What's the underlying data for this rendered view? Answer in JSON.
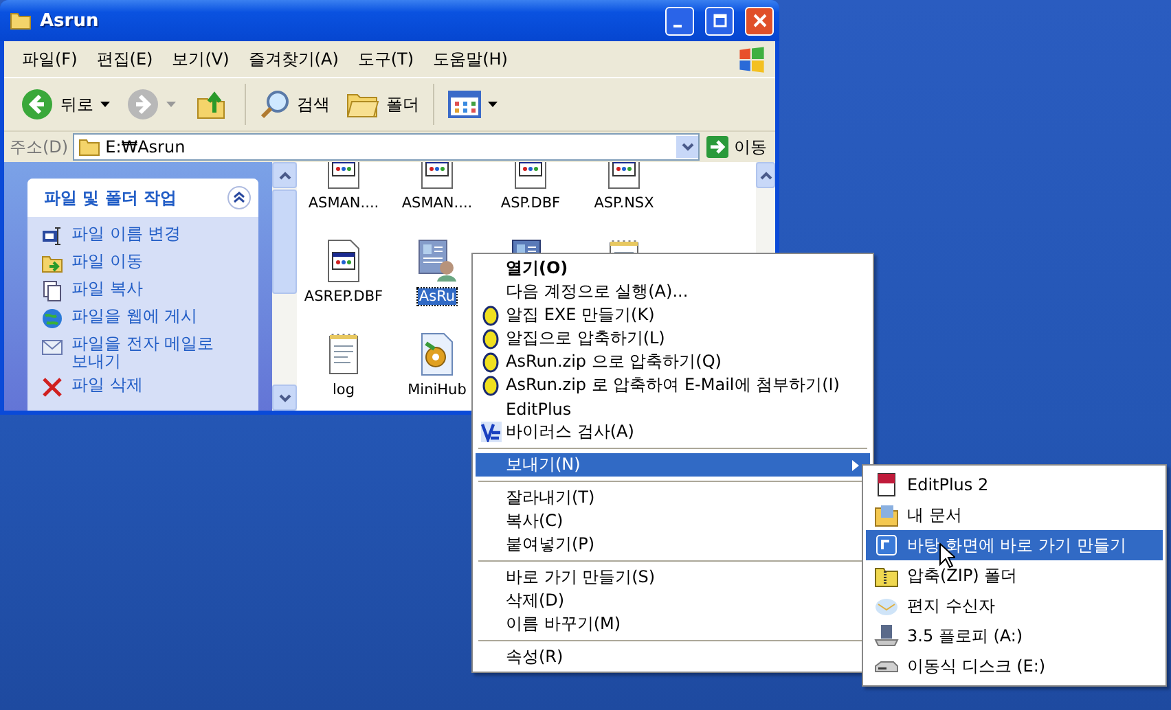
{
  "window": {
    "title": "Asrun"
  },
  "menu_bar": [
    "파일(F)",
    "편집(E)",
    "보기(V)",
    "즐겨찾기(A)",
    "도구(T)",
    "도움말(H)"
  ],
  "toolbar": {
    "back": "뒤로",
    "search": "검색",
    "folders": "폴더"
  },
  "address": {
    "label": "주소(D)",
    "value": "E:₩Asrun",
    "go": "이동"
  },
  "task_panel": {
    "title": "파일 및 폴더 작업",
    "tasks": [
      {
        "label": "파일 이름 변경",
        "kind": "rename"
      },
      {
        "label": "파일 이동",
        "kind": "move"
      },
      {
        "label": "파일 복사",
        "kind": "copy"
      },
      {
        "label": "파일을 웹에 게시",
        "kind": "web"
      },
      {
        "label": "파일을 전자 메일로 보내기",
        "kind": "mail"
      },
      {
        "label": "파일 삭제",
        "kind": "delete"
      }
    ]
  },
  "files": [
    {
      "name": "ASMAN....",
      "kind": "dbf",
      "selected": false
    },
    {
      "name": "ASMAN....",
      "kind": "dbf",
      "selected": false
    },
    {
      "name": "ASP.DBF",
      "kind": "dbf",
      "selected": false
    },
    {
      "name": "ASP.NSX",
      "kind": "dbf",
      "selected": false
    },
    {
      "name": "ASREP.DBF",
      "kind": "dbf",
      "selected": false
    },
    {
      "name": "AsRu",
      "kind": "user",
      "selected": true
    },
    {
      "kind": "card",
      "selected": false
    },
    {
      "kind": "notepad",
      "selected": false
    },
    {
      "name": "log",
      "kind": "notepad",
      "selected": false
    },
    {
      "name": "MiniHub",
      "kind": "gear",
      "selected": false
    }
  ],
  "context_menu": [
    [
      {
        "label": "열기(O)",
        "kind": "default",
        "selected": false
      },
      {
        "label": "다음 계정으로 실행(A)...",
        "kind": "plain",
        "selected": false
      },
      {
        "label": "알집 EXE 만들기(K)",
        "kind": "alzip",
        "selected": false
      },
      {
        "label": "알집으로 압축하기(L)",
        "kind": "alzip",
        "selected": false
      },
      {
        "label": "AsRun.zip 으로 압축하기(Q)",
        "kind": "alzip",
        "selected": false
      },
      {
        "label": "AsRun.zip 로 압축하여 E-Mail에 첨부하기(I)",
        "kind": "alzip",
        "selected": false
      },
      {
        "label": "EditPlus",
        "kind": "plain",
        "selected": false
      },
      {
        "label": "바이러스 검사(A)",
        "kind": "virus",
        "selected": false
      }
    ],
    [
      {
        "label": "보내기(N)",
        "kind": "submenu",
        "selected": true
      }
    ],
    [
      {
        "label": "잘라내기(T)",
        "kind": "plain",
        "selected": false
      },
      {
        "label": "복사(C)",
        "kind": "plain",
        "selected": false
      },
      {
        "label": "붙여넣기(P)",
        "kind": "plain",
        "selected": false
      }
    ],
    [
      {
        "label": "바로 가기 만들기(S)",
        "kind": "plain",
        "selected": false
      },
      {
        "label": "삭제(D)",
        "kind": "plain",
        "selected": false
      },
      {
        "label": "이름 바꾸기(M)",
        "kind": "plain",
        "selected": false
      }
    ],
    [
      {
        "label": "속성(R)",
        "kind": "plain",
        "selected": false
      }
    ]
  ],
  "send_to_menu": [
    {
      "label": "EditPlus 2",
      "kind": "editplus",
      "selected": false
    },
    {
      "label": "내 문서",
      "kind": "documents",
      "selected": false
    },
    {
      "label": "바탕 화면에 바로 가기 만들기",
      "kind": "desktop",
      "selected": true
    },
    {
      "label": "압축(ZIP) 폴더",
      "kind": "zip",
      "selected": false
    },
    {
      "label": "편지 수신자",
      "kind": "mail",
      "selected": false
    },
    {
      "label": "3.5 플로피 (A:)",
      "kind": "floppy",
      "selected": false
    },
    {
      "label": "이동식 디스크 (E:)",
      "kind": "disk",
      "selected": false
    }
  ]
}
